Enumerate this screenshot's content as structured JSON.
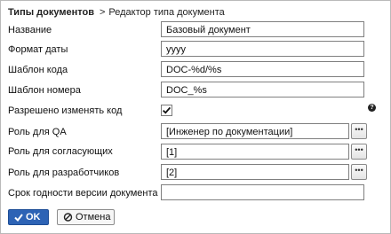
{
  "breadcrumb": {
    "root": "Типы документов",
    "separator": ">",
    "current": "Редактор типа документа"
  },
  "form": {
    "name": {
      "label": "Название",
      "value": "Базовый документ"
    },
    "date_format": {
      "label": "Формат даты",
      "value": "yyyy"
    },
    "code_template": {
      "label": "Шаблон кода",
      "value": "DOC-%d/%s"
    },
    "number_template": {
      "label": "Шаблон номера",
      "value": "DOC_%s"
    },
    "allow_code_change": {
      "label": "Разрешено изменять код",
      "checked": true
    },
    "qa_role": {
      "label": "Роль для QA",
      "value": "[Инженер по документации]",
      "button": "•••"
    },
    "approver_role": {
      "label": "Роль для согласующих",
      "value": "[1]",
      "button": "•••"
    },
    "developer_role": {
      "label": "Роль для разработчиков",
      "value": "[2]",
      "button": "•••"
    },
    "validity_period": {
      "label": "Срок годности версии документа (лет)",
      "value": ""
    }
  },
  "help_icon": {
    "glyph": "?",
    "icon": "help-icon"
  },
  "buttons": {
    "ok": {
      "label": "OK",
      "icon": "checkmark-icon"
    },
    "cancel": {
      "label": "Отмена",
      "icon": "cancel-circle-icon"
    }
  },
  "colors": {
    "primary_button": "#2d63b5",
    "border": "#7f7f7f"
  }
}
